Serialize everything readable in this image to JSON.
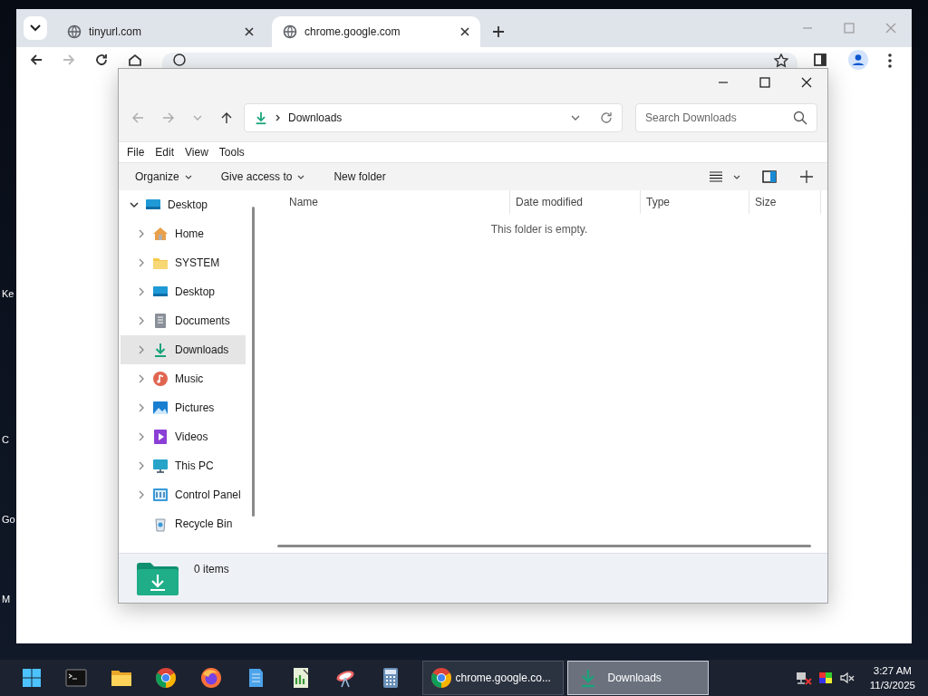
{
  "desktop": {
    "icon_labels": [
      "Ke",
      "C",
      "Go",
      "M"
    ]
  },
  "browser": {
    "tabs": [
      {
        "title": "tinyurl.com",
        "selected": false
      },
      {
        "title": "chrome.google.com",
        "selected": true
      }
    ]
  },
  "explorer": {
    "breadcrumb": "Downloads",
    "search": {
      "placeholder": "Search Downloads"
    },
    "menu": [
      "File",
      "Edit",
      "View",
      "Tools"
    ],
    "commands": [
      {
        "label": "Organize",
        "dropdown": true
      },
      {
        "label": "Give access to",
        "dropdown": true
      },
      {
        "label": "New folder",
        "dropdown": false
      }
    ],
    "tree": [
      {
        "label": "Desktop",
        "kind": "desktop",
        "expanded": true,
        "has_children": true,
        "selected": false,
        "children": [
          {
            "label": "Home",
            "kind": "home",
            "expanded": false,
            "has_children": true,
            "selected": false
          },
          {
            "label": "SYSTEM",
            "kind": "folder",
            "expanded": false,
            "has_children": true,
            "selected": false
          },
          {
            "label": "Desktop",
            "kind": "desktop",
            "expanded": false,
            "has_children": true,
            "selected": false
          },
          {
            "label": "Documents",
            "kind": "documents",
            "expanded": false,
            "has_children": true,
            "selected": false
          },
          {
            "label": "Downloads",
            "kind": "download",
            "expanded": false,
            "has_children": true,
            "selected": true
          },
          {
            "label": "Music",
            "kind": "music",
            "expanded": false,
            "has_children": true,
            "selected": false
          },
          {
            "label": "Pictures",
            "kind": "pictures",
            "expanded": false,
            "has_children": true,
            "selected": false
          },
          {
            "label": "Videos",
            "kind": "videos",
            "expanded": false,
            "has_children": true,
            "selected": false
          },
          {
            "label": "This PC",
            "kind": "pc",
            "expanded": false,
            "has_children": true,
            "selected": false
          },
          {
            "label": "Control Panel",
            "kind": "control",
            "expanded": false,
            "has_children": true,
            "selected": false
          },
          {
            "label": "Recycle Bin",
            "kind": "recycle",
            "has_children": false,
            "selected": false
          }
        ]
      }
    ],
    "columns": [
      "Name",
      "Date modified",
      "Type",
      "Size"
    ],
    "empty_message": "This folder is empty.",
    "status": "0 items"
  },
  "taskbar": {
    "pinned": [
      {
        "kind": "start"
      },
      {
        "kind": "terminal"
      },
      {
        "kind": "folder"
      },
      {
        "kind": "chrome"
      },
      {
        "kind": "firefox"
      },
      {
        "kind": "notepad"
      },
      {
        "kind": "chart"
      },
      {
        "kind": "dish"
      },
      {
        "kind": "calculator"
      }
    ],
    "windows": [
      {
        "title": "chrome.google.co...",
        "kind": "chrome",
        "selected": false
      },
      {
        "title": "Downloads",
        "kind": "download",
        "selected": true
      }
    ],
    "time": "3:27 AM",
    "date": "11/3/2025"
  }
}
